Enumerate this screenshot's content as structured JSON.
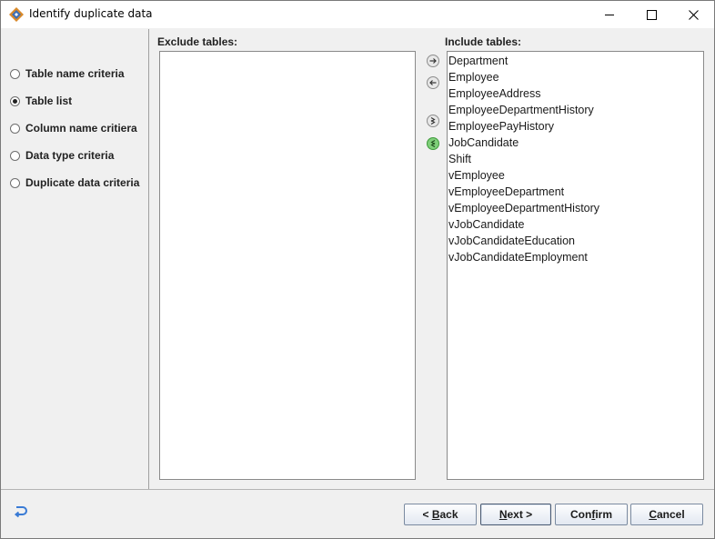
{
  "window": {
    "title": "Identify duplicate data",
    "controls": [
      "minimize-icon",
      "maximize-icon",
      "close-icon"
    ]
  },
  "sidebar": {
    "items": [
      {
        "label": "Table name criteria",
        "selected": false
      },
      {
        "label": "Table list",
        "selected": true
      },
      {
        "label": "Column name critiera",
        "selected": false
      },
      {
        "label": "Data type criteria",
        "selected": false
      },
      {
        "label": "Duplicate data criteria",
        "selected": false
      }
    ]
  },
  "exclude": {
    "label": "Exclude tables:",
    "items": []
  },
  "include": {
    "label": "Include tables:",
    "items": [
      "Department",
      "Employee",
      "EmployeeAddress",
      "EmployeeDepartmentHistory",
      "EmployeePayHistory",
      "JobCandidate",
      "Shift",
      "vEmployee",
      "vEmployeeDepartment",
      "vEmployeeDepartmentHistory",
      "vJobCandidate",
      "vJobCandidateEducation",
      "vJobCandidateEmployment"
    ]
  },
  "transfer_buttons": [
    "move-right-icon",
    "move-left-icon",
    "move-all-right-icon",
    "move-all-left-icon"
  ],
  "footer": {
    "back_prefix": "< ",
    "back_mnemonic": "B",
    "back_rest": "ack",
    "next_mnemonic": "N",
    "next_rest": "ext >",
    "confirm_pre": "Con",
    "confirm_mnemonic": "f",
    "confirm_rest": "irm",
    "cancel_mnemonic": "C",
    "cancel_rest": "ancel"
  },
  "colors": {
    "arrow_grey": "#8c8c8c",
    "arrow_green": "#4caf50",
    "button_border": "#7a8aa0"
  }
}
